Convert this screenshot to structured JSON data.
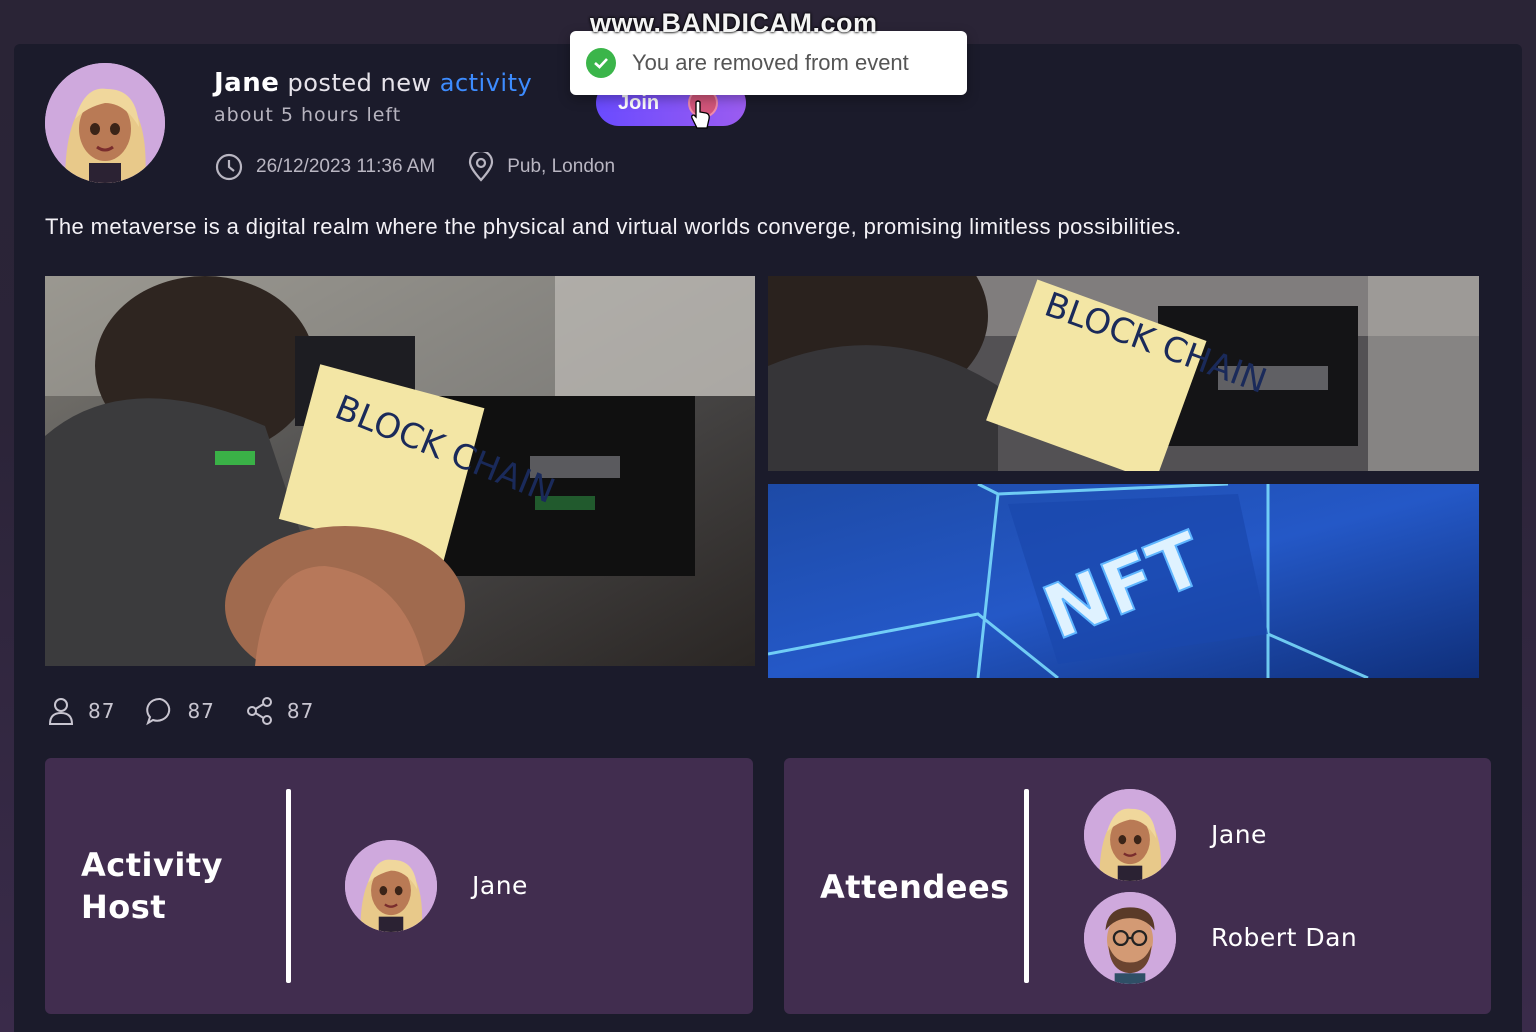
{
  "watermark": "www.BANDICAM.com",
  "post": {
    "author": "Jane",
    "action": "posted new",
    "link_text": "activity",
    "time_left": "about 5 hours left",
    "datetime": "26/12/2023 11:36 AM",
    "location": "Pub, London",
    "description": "The metaverse is a digital realm where the physical and virtual worlds converge, promising limitless possibilities.",
    "join_label": "Join",
    "images": [
      {
        "caption": "BLOCK CHAIN"
      },
      {
        "caption": "BLOCK CHAIN"
      },
      {
        "caption": "NFT"
      }
    ],
    "stats": {
      "attendees_count": "87",
      "comments_count": "87",
      "shares_count": "87"
    }
  },
  "toast": {
    "message": "You are removed from event",
    "status_color": "#3bb54a"
  },
  "host_panel": {
    "title_line1": "Activity",
    "title_line2": "Host",
    "host_name": "Jane"
  },
  "attendees_panel": {
    "title": "Attendees",
    "attendees": [
      "Jane",
      "Robert Dan"
    ]
  },
  "colors": {
    "link": "#3d8cff",
    "panel": "#412d4f",
    "card": "#1b1b2b"
  }
}
